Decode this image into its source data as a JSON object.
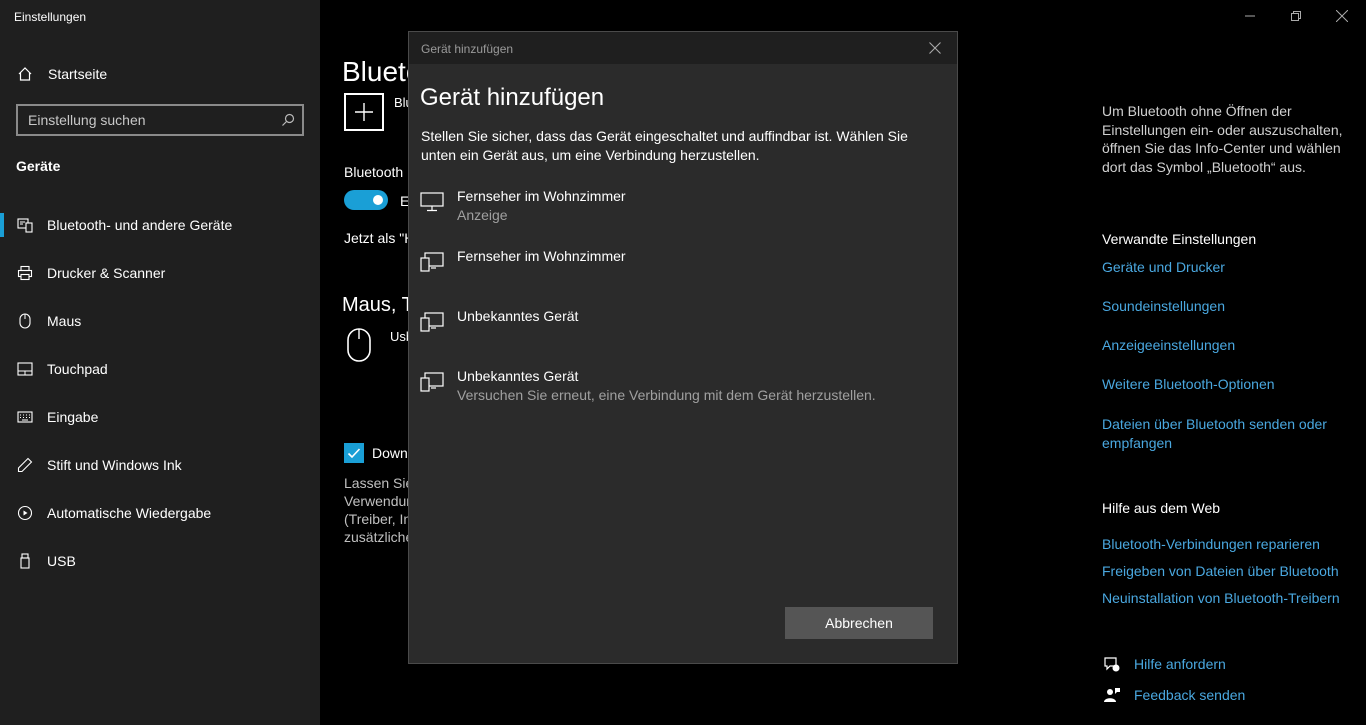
{
  "app": {
    "title": "Einstellungen"
  },
  "sidebar": {
    "home_label": "Startseite",
    "search_placeholder": "Einstellung suchen",
    "section_title": "Geräte",
    "items": [
      {
        "label": "Bluetooth- und andere Geräte",
        "icon": "bluetooth-devices-icon",
        "active": true
      },
      {
        "label": "Drucker & Scanner",
        "icon": "printer-icon",
        "active": false
      },
      {
        "label": "Maus",
        "icon": "mouse-icon",
        "active": false
      },
      {
        "label": "Touchpad",
        "icon": "touchpad-icon",
        "active": false
      },
      {
        "label": "Eingabe",
        "icon": "keyboard-icon",
        "active": false
      },
      {
        "label": "Stift und Windows Ink",
        "icon": "pen-icon",
        "active": false
      },
      {
        "label": "Automatische Wiedergabe",
        "icon": "autoplay-icon",
        "active": false
      },
      {
        "label": "USB",
        "icon": "usb-icon",
        "active": false
      }
    ]
  },
  "main": {
    "page_title": "Blueto",
    "add_label": "Blu",
    "bt_label": "Bluetooth",
    "toggle_label": "Ei",
    "toggle_on": true,
    "visible_as": "Jetzt als \"H",
    "mouse_heading": "Maus, T",
    "usb_label": "Usb",
    "checkbox_label": "Down",
    "checkbox_checked": true,
    "desc_lines": [
      "Lassen Sie",
      "Verwendun",
      "(Treiber, In",
      "zusätzliche"
    ]
  },
  "right": {
    "help_text": "Um Bluetooth ohne Öffnen der Einstellungen ein- oder auszuschalten, öffnen Sie das Info-Center und wählen dort das Symbol „Bluetooth“ aus.",
    "related_heading": "Verwandte Einstellungen",
    "related_links": [
      "Geräte und Drucker",
      "Soundeinstellungen",
      "Anzeigeeinstellungen",
      "Weitere Bluetooth-Optionen",
      "Dateien über Bluetooth senden oder empfangen"
    ],
    "web_heading": "Hilfe aus dem Web",
    "web_links": [
      "Bluetooth-Verbindungen reparieren",
      "Freigeben von Dateien über Bluetooth",
      "Neuinstallation von Bluetooth-Treibern"
    ],
    "help_request": "Hilfe anfordern",
    "feedback": "Feedback senden"
  },
  "dialog": {
    "titlebar": "Gerät hinzufügen",
    "heading": "Gerät hinzufügen",
    "description": "Stellen Sie sicher, dass das Gerät eingeschaltet und auffindbar ist. Wählen Sie unten ein Gerät aus, um eine Verbindung herzustellen.",
    "devices": [
      {
        "name": "Fernseher im Wohnzimmer",
        "sub": "Anzeige",
        "icon": "monitor-icon"
      },
      {
        "name": "Fernseher im Wohnzimmer",
        "sub": "",
        "icon": "devices-icon"
      },
      {
        "name": "Unbekanntes Gerät",
        "sub": "",
        "icon": "devices-icon"
      },
      {
        "name": "Unbekanntes Gerät",
        "sub": "Versuchen Sie erneut, eine Verbindung mit dem Gerät herzustellen.",
        "icon": "devices-icon"
      }
    ],
    "cancel_label": "Abbrechen"
  },
  "colors": {
    "accent": "#1a9fd6",
    "link": "#4aa8e0",
    "sidebar_bg": "#1f1f1f",
    "dialog_bg": "#2b2b2b"
  }
}
